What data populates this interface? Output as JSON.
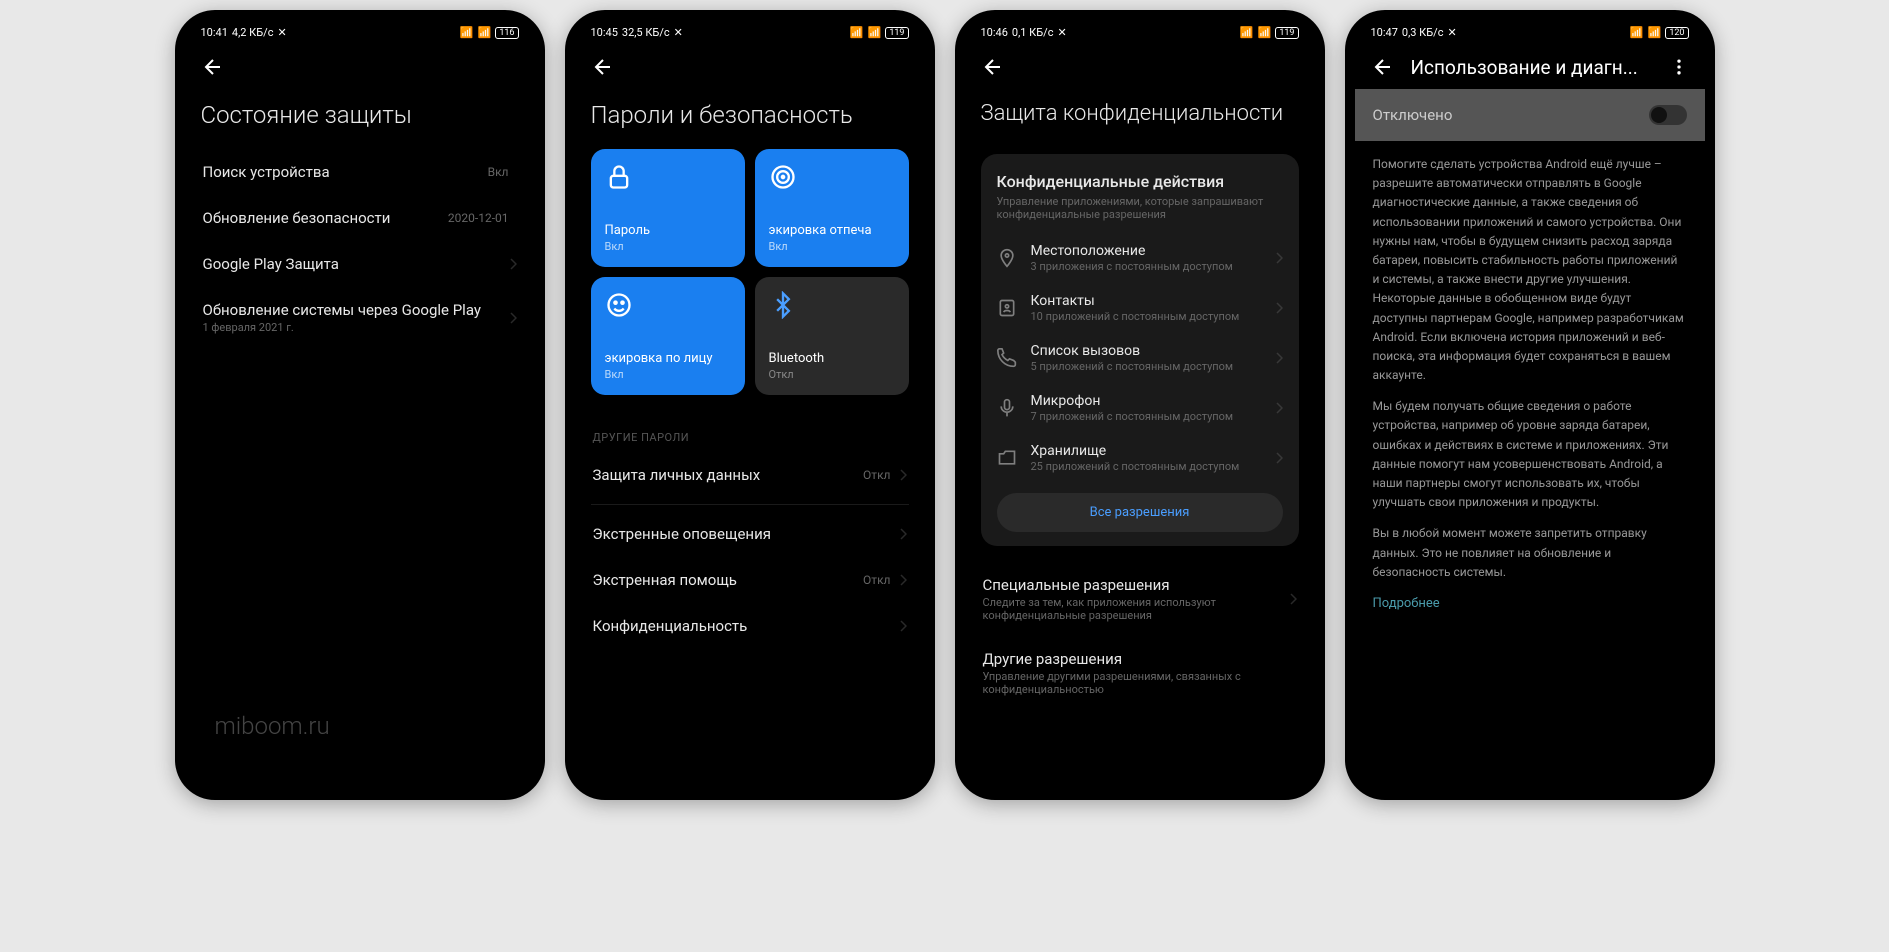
{
  "watermark": "miboom.ru",
  "phone1": {
    "status": {
      "time": "10:41",
      "speed": "4,2 КБ/с",
      "battery": "116"
    },
    "title": "Состояние защиты",
    "items": [
      {
        "title": "Поиск устройства",
        "value": "Вкл",
        "sub": ""
      },
      {
        "title": "Обновление безопасности",
        "value": "2020-12-01",
        "sub": ""
      },
      {
        "title": "Google Play Защита",
        "value": "",
        "sub": "",
        "chevron": true
      },
      {
        "title": "Обновление системы через Google Play",
        "value": "",
        "sub": "1 февраля 2021 г.",
        "chevron": true
      }
    ]
  },
  "phone2": {
    "status": {
      "time": "10:45",
      "speed": "32,5 КБ/с",
      "battery": "119"
    },
    "title": "Пароли и безопасность",
    "tiles": [
      {
        "label": "Пароль",
        "status": "Вкл",
        "color": "blue",
        "icon": "lock"
      },
      {
        "label": "экировка отпеча",
        "status": "Вкл",
        "color": "blue",
        "icon": "fingerprint"
      },
      {
        "label": "экировка по лицу",
        "status": "Вкл",
        "color": "blue",
        "icon": "face"
      },
      {
        "label": "Bluetooth",
        "status": "Откл",
        "color": "dark",
        "icon": "bluetooth"
      }
    ],
    "section_header": "ДРУГИЕ ПАРОЛИ",
    "items": [
      {
        "title": "Защита личных данных",
        "value": "Откл"
      },
      {
        "title": "Экстренные оповещения",
        "value": ""
      },
      {
        "title": "Экстренная помощь",
        "value": "Откл"
      },
      {
        "title": "Конфиденциальность",
        "value": ""
      }
    ]
  },
  "phone3": {
    "status": {
      "time": "10:46",
      "speed": "0,1 КБ/с",
      "battery": "119"
    },
    "title": "Защита конфиденциальности",
    "card": {
      "title": "Конфиденциальные действия",
      "sub": "Управление приложениями, которые запрашивают конфиденциальные разрешения",
      "perms": [
        {
          "title": "Местоположение",
          "sub": "3 приложения с постоянным доступом",
          "icon": "location"
        },
        {
          "title": "Контакты",
          "sub": "10 приложений с постоянным доступом",
          "icon": "contacts"
        },
        {
          "title": "Список вызовов",
          "sub": "5 приложений с постоянным доступом",
          "icon": "phone"
        },
        {
          "title": "Микрофон",
          "sub": "7 приложений с постоянным доступом",
          "icon": "mic"
        },
        {
          "title": "Хранилище",
          "sub": "25 приложений с постоянным доступом",
          "icon": "storage"
        }
      ],
      "all_btn": "Все разрешения"
    },
    "after": [
      {
        "title": "Специальные разрешения",
        "sub": "Следите за тем, как приложения используют конфиденциальные разрешения"
      },
      {
        "title": "Другие разрешения",
        "sub": "Управление другими разрешениями, связанных с конфиденциальностью"
      }
    ]
  },
  "phone4": {
    "status": {
      "time": "10:47",
      "speed": "0,3 КБ/с",
      "battery": "120"
    },
    "title": "Использование и диагн...",
    "toggle_label": "Отключено",
    "paragraphs": [
      "Помогите сделать устройства Android ещё лучше – разрешите автоматически отправлять в Google диагностические данные, а также сведения об использовании приложений и самого устройства. Они нужны нам, чтобы в будущем снизить расход заряда батареи, повысить стабильность работы приложений и системы, а также внести другие улучшения. Некоторые данные в обобщенном виде будут доступны партнерам Google, например разработчикам Android. Если включена история приложений и веб-поиска, эта информация будет сохраняться в вашем аккаунте.",
      "Мы будем получать общие сведения о работе устройства, например об уровне заряда батареи, ошибках и действиях в системе и приложениях. Эти данные помогут нам усовершенствовать Android, а наши партнеры смогут использовать их, чтобы улучшать свои приложения и продукты.",
      "Вы в любой момент можете запретить отправку данных. Это не повлияет на обновление и безопасность системы."
    ],
    "link": "Подробнее"
  }
}
